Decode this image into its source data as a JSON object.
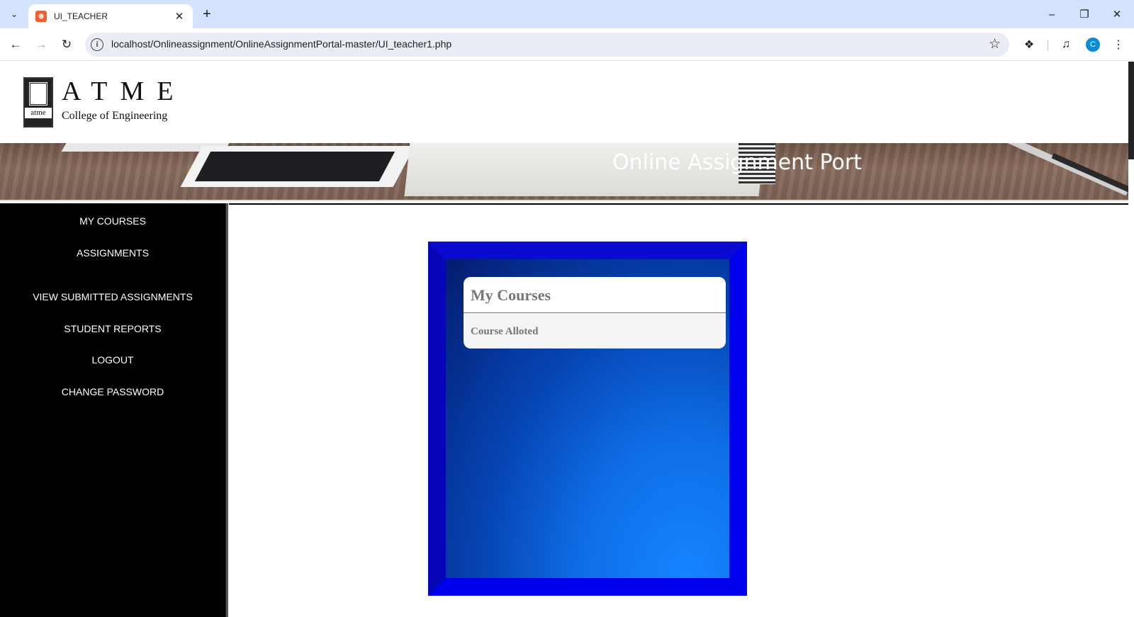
{
  "browser": {
    "tab_title": "UI_TEACHER",
    "url": "localhost/Onlineassignment/OnlineAssignmentPortal-master/UI_teacher1.php",
    "profile_initial": "C"
  },
  "site": {
    "logo_name": "ATME",
    "logo_sub": "College of Engineering",
    "logo_word": "atme",
    "banner_text": "Online Assignment Portal"
  },
  "sidebar": {
    "items": [
      {
        "label": "MY COURSES"
      },
      {
        "label": "ASSIGNMENTS"
      },
      {
        "label": "VIEW SUBMITTED ASSIGNMENTS"
      },
      {
        "label": "STUDENT REPORTS"
      },
      {
        "label": "LOGOUT"
      },
      {
        "label": "CHANGE PASSWORD"
      }
    ]
  },
  "main": {
    "card_title": "My Courses",
    "card_field": "Course Alloted"
  },
  "colors": {
    "sidebar_bg": "#000000",
    "frame_blue": "#0000f0",
    "tab_bar": "#d3e3fd"
  }
}
